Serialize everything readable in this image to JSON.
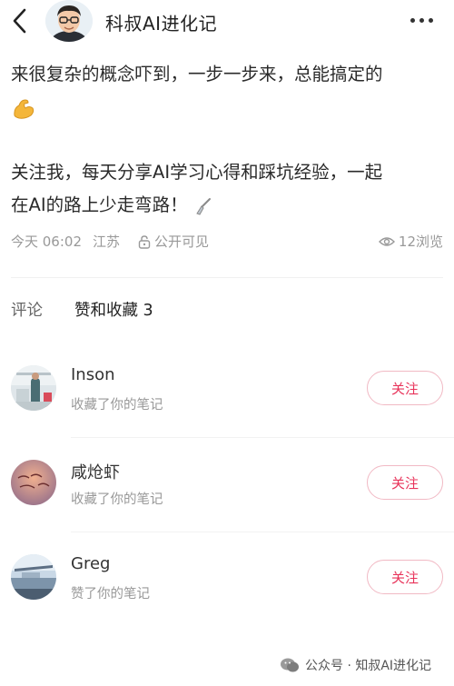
{
  "header": {
    "author_name": "科叔AI进化记",
    "back_icon": "chevron-left-icon",
    "more_icon": "more-dots-icon"
  },
  "content": {
    "line1": "来很复杂的概念吓到，一步一步来，总能搞定的",
    "line2_emoji": "flexed-biceps-emoji",
    "line3": "关注我，每天分享AI学习心得和踩坑经验，一起",
    "line4": "在AI的路上少走弯路！"
  },
  "meta": {
    "time": "今天 06:02",
    "location": "江苏",
    "visibility": "公开可见",
    "views": "12浏览"
  },
  "tabs": {
    "comments": "评论",
    "likes": "赞和收藏 3"
  },
  "interactions": [
    {
      "name": "Inson",
      "action": "收藏了你的笔记",
      "follow": "关注"
    },
    {
      "name": "咸炝虾",
      "action": "收藏了你的笔记",
      "follow": "关注"
    },
    {
      "name": "Greg",
      "action": "赞了你的笔记",
      "follow": "关注"
    }
  ],
  "watermark": {
    "text": "公众号 · 知叔AI进化记"
  },
  "colors": {
    "accent": "#e8335a",
    "follow_border": "#f1b9c4",
    "meta_text": "#999999"
  }
}
